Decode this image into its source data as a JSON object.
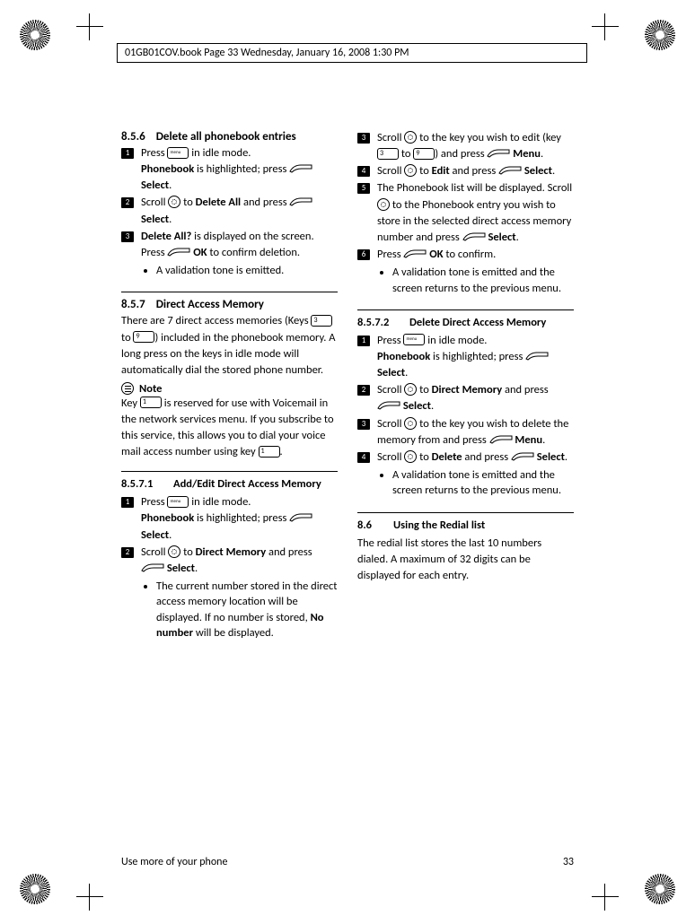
{
  "header": {
    "running_head": "01GB01COV.book  Page 33  Wednesday, January 16, 2008  1:30 PM"
  },
  "footer": {
    "section_label": "Use more of your phone",
    "page_number": "33"
  },
  "left": {
    "sec856": {
      "num": "8.5.6",
      "title": "Delete all phonebook entries",
      "step1_a": "Press ",
      "step1_b": " in idle mode.",
      "step1_c1": "Phonebook",
      "step1_c2": " is highlighted; press ",
      "step1_d": " Select",
      "step1_e": ".",
      "step2_a": "Scroll ",
      "step2_b": " to ",
      "step2_c": "Delete All",
      "step2_d": " and press ",
      "step2_e": " Select",
      "step2_f": ".",
      "step3_a": "Delete All?",
      "step3_b": " is displayed on the screen. Press ",
      "step3_c": " OK",
      "step3_d": " to confirm deletion.",
      "step3_bullet": "A validation tone is emitted."
    },
    "sec857": {
      "num": "8.5.7",
      "title": "Direct Access Memory",
      "intro_a": "There are 7 direct access memories (Keys ",
      "intro_key1": "3",
      "intro_b": " to ",
      "intro_key2": "9",
      "intro_c": ") included in the phonebook memory. A long press on the keys in idle mode will automatically dial the stored phone number.",
      "note_label": "Note",
      "note_a": "Key ",
      "note_key": "1",
      "note_b": " is reserved for use with Voicemail in the network services menu. If you subscribe to this service, this allows you to dial your voice mail access number using key ",
      "note_key2": "1",
      "note_c": "."
    },
    "sec8571": {
      "num": "8.5.7.1",
      "title": "Add/Edit Direct Access Memory",
      "step1_a": "Press ",
      "step1_b": " in idle mode.",
      "step1_c1": "Phonebook",
      "step1_c2": " is highlighted; press ",
      "step1_d": " Select",
      "step1_e": ".",
      "step2_a": "Scroll ",
      "step2_b": " to ",
      "step2_c": "Direct Memory",
      "step2_d": " and press ",
      "step2_e": " Select",
      "step2_f": ".",
      "step2_bullet_a": "The current number stored in the direct access memory location will be displayed. If no number is stored, ",
      "step2_bullet_b": "No number",
      "step2_bullet_c": " will be displayed."
    }
  },
  "right": {
    "cont": {
      "step3_a": "Scroll ",
      "step3_b": " to the key you wish to edit (key ",
      "step3_key1": "3",
      "step3_c": " to ",
      "step3_key2": "9",
      "step3_d": ") and press ",
      "step3_e": " Menu",
      "step3_f": ".",
      "step4_a": "Scroll ",
      "step4_b": " to ",
      "step4_c": "Edit",
      "step4_d": " and press ",
      "step4_e": " Select",
      "step4_f": ".",
      "step5_a": "The Phonebook list will be displayed. Scroll ",
      "step5_b": " to the Phonebook entry you wish to store in the selected direct access memory number and press ",
      "step5_c": " Select",
      "step5_d": ".",
      "step6_a": "Press ",
      "step6_b": " OK",
      "step6_c": " to confirm.",
      "step6_bullet": "A validation tone is emitted and the screen returns to the previous menu."
    },
    "sec8572": {
      "num": "8.5.7.2",
      "title": "Delete Direct Access Memory",
      "step1_a": "Press ",
      "step1_b": " in idle mode.",
      "step1_c1": "Phonebook",
      "step1_c2": " is highlighted; press ",
      "step1_d": " Select",
      "step1_e": ".",
      "step2_a": "Scroll ",
      "step2_b": " to ",
      "step2_c": "Direct Memory",
      "step2_d": " and press ",
      "step2_e": " Select",
      "step2_f": ".",
      "step3_a": "Scroll ",
      "step3_b": " to the key you wish to delete the memory from and press ",
      "step3_c": " Menu",
      "step3_d": ".",
      "step4_a": "Scroll ",
      "step4_b": " to ",
      "step4_c": "Delete",
      "step4_d": " and press ",
      "step4_e": " Select",
      "step4_f": ".",
      "step4_bullet": "A validation tone is emitted and the screen returns to the previous menu."
    },
    "sec86": {
      "num": "8.6",
      "title": "Using the Redial list",
      "body": "The redial list stores the last 10 numbers dialed. A maximum of 32 digits can be displayed for each entry."
    }
  }
}
